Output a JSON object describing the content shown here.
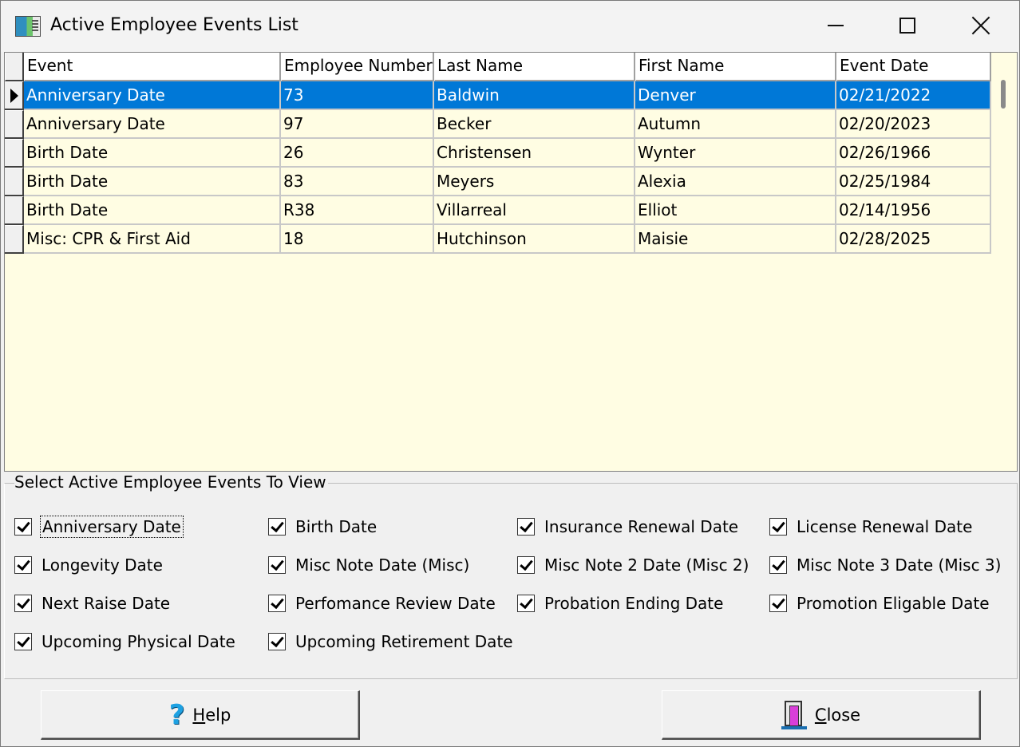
{
  "window": {
    "title": "Active Employee Events List",
    "icon": "app-icon",
    "controls": [
      "minimize-icon",
      "maximize-icon",
      "close-icon"
    ]
  },
  "grid": {
    "columns": [
      "Event",
      "Employee Number",
      "Last Name",
      "First Name",
      "Event Date"
    ],
    "selected_row": 0,
    "rows": [
      [
        "Anniversary Date",
        "73",
        "Baldwin",
        "Denver",
        "02/21/2022"
      ],
      [
        "Anniversary Date",
        "97",
        "Becker",
        "Autumn",
        "02/20/2023"
      ],
      [
        "Birth Date",
        "26",
        "Christensen",
        "Wynter",
        "02/26/1966"
      ],
      [
        "Birth Date",
        "83",
        "Meyers",
        "Alexia",
        "02/25/1984"
      ],
      [
        "Birth Date",
        "R38",
        "Villarreal",
        "Elliot",
        "02/14/1956"
      ],
      [
        "Misc: CPR & First Aid",
        "18",
        "Hutchinson",
        "Maisie",
        "02/28/2025"
      ]
    ],
    "colors": {
      "background": "#fffde3",
      "selection": "#0078d7"
    }
  },
  "filters": {
    "title": "Select Active Employee Events To View",
    "items": [
      {
        "label": "Anniversary Date",
        "checked": true
      },
      {
        "label": "Birth Date",
        "checked": true
      },
      {
        "label": "Insurance Renewal Date",
        "checked": true
      },
      {
        "label": "License Renewal Date",
        "checked": true
      },
      {
        "label": "Longevity Date",
        "checked": true
      },
      {
        "label": "Misc Note Date (Misc)",
        "checked": true
      },
      {
        "label": "Misc Note 2 Date (Misc 2)",
        "checked": true
      },
      {
        "label": "Misc Note 3 Date (Misc 3)",
        "checked": true
      },
      {
        "label": "Next Raise Date",
        "checked": true
      },
      {
        "label": "Perfomance Review Date",
        "checked": true
      },
      {
        "label": "Probation Ending Date",
        "checked": true
      },
      {
        "label": "Promotion Eligable Date",
        "checked": true
      },
      {
        "label": "Upcoming Physical Date",
        "checked": true
      },
      {
        "label": "Upcoming Retirement Date",
        "checked": true
      }
    ]
  },
  "buttons": {
    "help": {
      "mnemonic": "H",
      "rest": "elp",
      "icon": "help-question-icon"
    },
    "close": {
      "mnemonic": "C",
      "rest": "lose",
      "icon": "door-exit-icon"
    }
  }
}
